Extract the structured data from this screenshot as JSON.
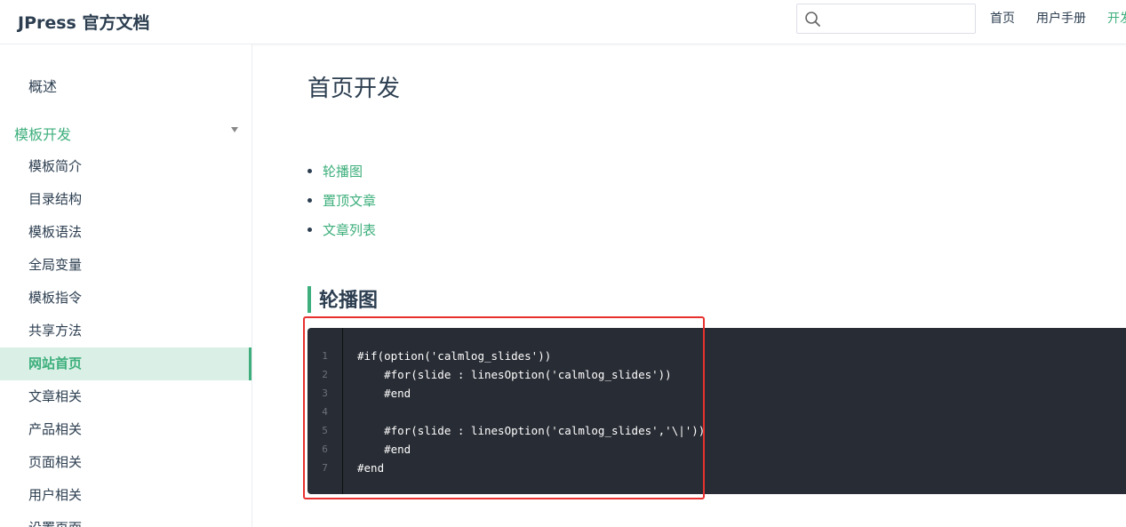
{
  "header": {
    "site_title": "JPress 官方文档",
    "search": {
      "value": "",
      "placeholder": ""
    },
    "nav": [
      {
        "label": "首页"
      },
      {
        "label": "用户手册"
      },
      {
        "label": "开发文档"
      }
    ]
  },
  "sidebar": {
    "top_item": "概述",
    "group": {
      "title": "模板开发",
      "items": [
        {
          "label": "模板简介"
        },
        {
          "label": "目录结构"
        },
        {
          "label": "模板语法"
        },
        {
          "label": "全局变量"
        },
        {
          "label": "模板指令"
        },
        {
          "label": "共享方法"
        },
        {
          "label": "网站首页",
          "active": true
        },
        {
          "label": "文章相关"
        },
        {
          "label": "产品相关"
        },
        {
          "label": "页面相关"
        },
        {
          "label": "用户相关"
        },
        {
          "label": "设置页面"
        }
      ]
    }
  },
  "main": {
    "title": "首页开发",
    "toc": [
      {
        "label": "轮播图"
      },
      {
        "label": "置顶文章"
      },
      {
        "label": "文章列表"
      }
    ],
    "section_heading": "轮播图",
    "code": {
      "line_numbers": [
        "1",
        "2",
        "3",
        "4",
        "5",
        "6",
        "7"
      ],
      "lines": [
        "#if(option('calmlog_slides'))",
        "    #for(slide : linesOption('calmlog_slides'))",
        "    #end",
        "",
        "    #for(slide : linesOption('calmlog_slides','\\|'))",
        "    #end",
        "#end"
      ]
    }
  },
  "colors": {
    "accent": "#3eaf7c",
    "text": "#2c3e50",
    "code_background": "#282c34",
    "annotation": "#e8312f"
  }
}
